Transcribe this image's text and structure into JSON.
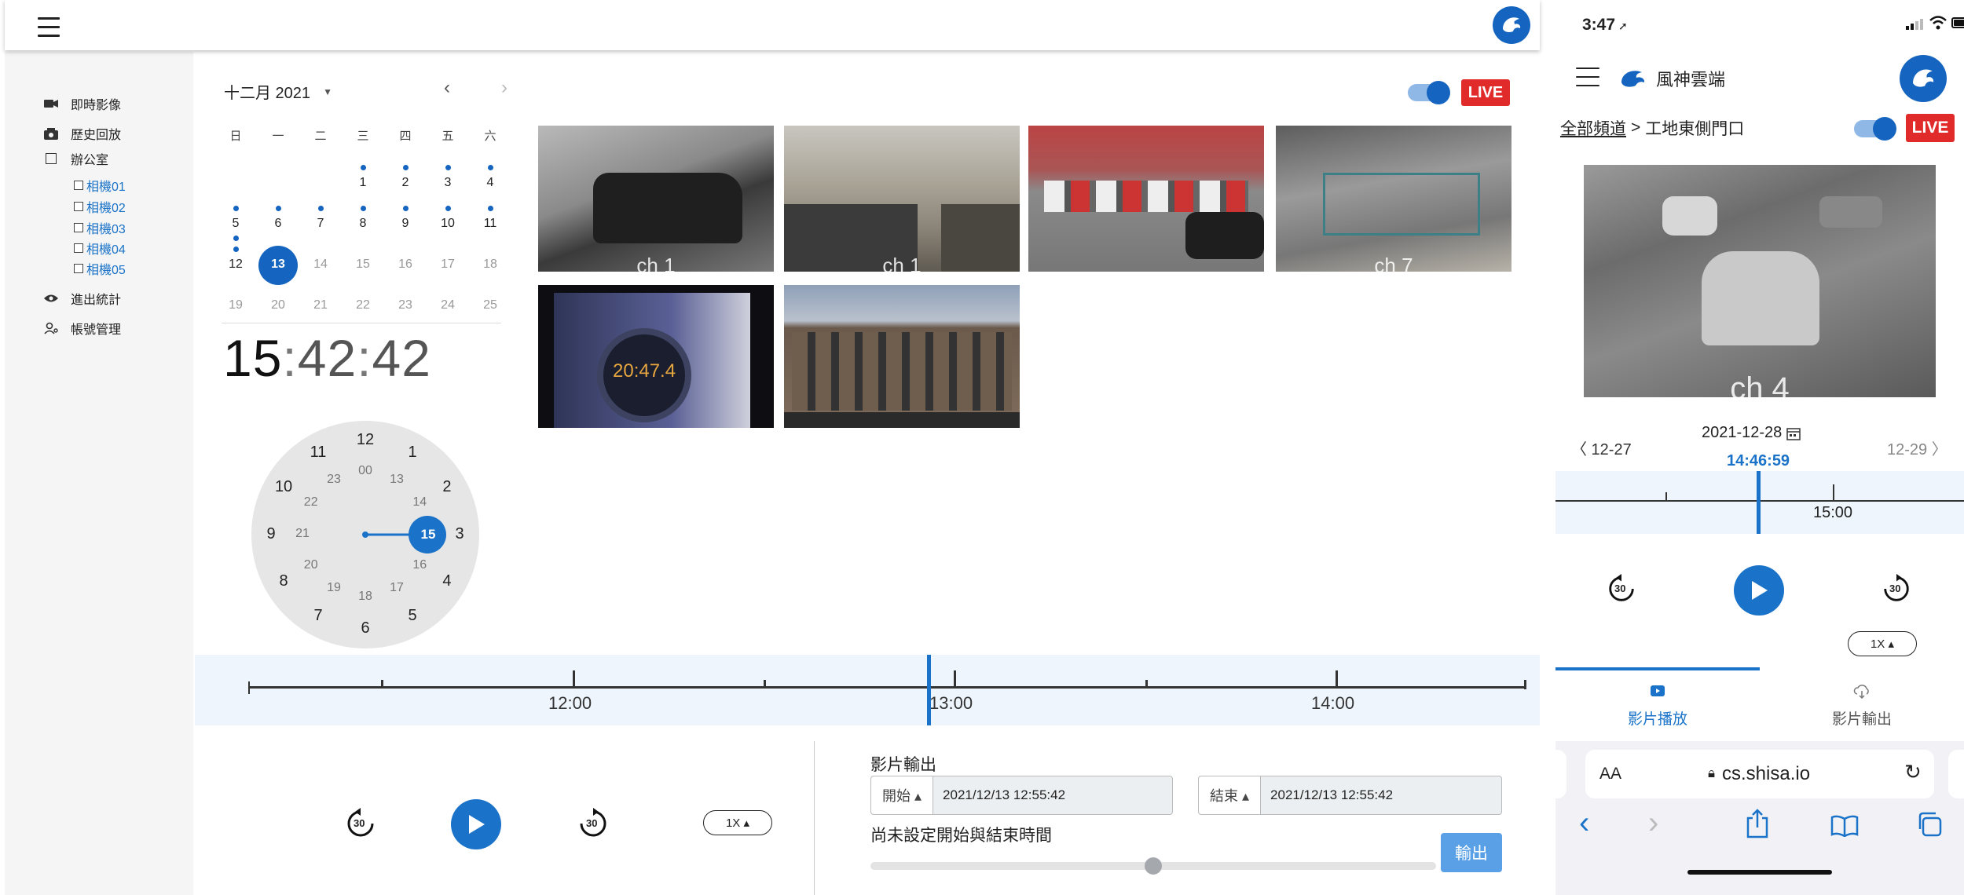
{
  "desktop": {
    "sidebar": {
      "items": [
        {
          "label": "即時影像",
          "icon": "video-camera-icon"
        },
        {
          "label": "歷史回放",
          "icon": "history-camera-icon"
        },
        {
          "label": "辦公室",
          "icon": "checkbox-icon"
        },
        {
          "label": "進出統計",
          "icon": "eye-icon"
        },
        {
          "label": "帳號管理",
          "icon": "user-settings-icon"
        }
      ],
      "cameras": [
        "相機01",
        "相機02",
        "相機03",
        "相機04",
        "相機05"
      ]
    },
    "calendar": {
      "month_label": "十二月 2021",
      "weekdays": [
        "日",
        "一",
        "二",
        "三",
        "四",
        "五",
        "六"
      ],
      "rows": [
        [
          "",
          "",
          "",
          "1",
          "2",
          "3",
          "4"
        ],
        [
          "5",
          "6",
          "7",
          "8",
          "9",
          "10",
          "11"
        ],
        [
          "12",
          "13",
          "14",
          "15",
          "16",
          "17",
          "18"
        ],
        [
          "19",
          "20",
          "21",
          "22",
          "23",
          "24",
          "25"
        ]
      ],
      "selected_day": "13",
      "dotted_days": [
        "1",
        "2",
        "3",
        "4",
        "5",
        "6",
        "7",
        "8",
        "9",
        "10",
        "11",
        "12"
      ]
    },
    "clock": {
      "hour": "15",
      "colon1": ":",
      "minute": "42",
      "colon2": ":",
      "second": "42",
      "outer_numbers": [
        "12",
        "1",
        "2",
        "3",
        "4",
        "5",
        "6",
        "7",
        "8",
        "9",
        "10",
        "11"
      ],
      "inner_numbers": [
        "00",
        "13",
        "14",
        "15",
        "16",
        "17",
        "18",
        "19",
        "20",
        "21",
        "22",
        "23"
      ],
      "selected": "15"
    },
    "live_label": "LIVE",
    "videos": [
      {
        "label": "ch 1"
      },
      {
        "label": "ch 1"
      },
      {
        "label": ""
      },
      {
        "label": "ch 7"
      },
      {
        "label": ""
      },
      {
        "label": ""
      }
    ],
    "video_overlay_time": "20:47.4",
    "timeline": {
      "ticks": [
        "12:00",
        "13:00",
        "14:00"
      ]
    },
    "playback": {
      "speed": "1X ▴",
      "skip_back": "30",
      "skip_fwd": "30"
    },
    "export": {
      "title": "影片輸出",
      "start_label": "開始 ▴",
      "start_value": "2021/12/13 12:55:42",
      "end_label": "結束 ▴",
      "end_value": "2021/12/13 12:55:42",
      "hint": "尚未設定開始與結束時間",
      "button": "輸出",
      "progress": 0.5
    }
  },
  "mobile": {
    "status": {
      "time": "3:47"
    },
    "brand": "風神雲端",
    "breadcrumb_root": "全部頻道",
    "breadcrumb_sep": ">",
    "breadcrumb_current": "工地東側門口",
    "live_label": "LIVE",
    "video_label": "ch 4",
    "date": "2021-12-28",
    "prev_day": "〈 12-27",
    "next_day": "12-29 〉",
    "current_time": "14:46:59",
    "timeline_tick": "15:00",
    "speed": "1X ▴",
    "skip": "30",
    "tabs": [
      {
        "label": "影片播放",
        "icon": "video-play-icon"
      },
      {
        "label": "影片輸出",
        "icon": "cloud-download-icon"
      }
    ],
    "browser": {
      "aa": "AA",
      "url": "cs.shisa.io"
    }
  },
  "colors": {
    "accent": "#1a73c8",
    "live": "#e12a2a",
    "sidebar": "#f5f5f5",
    "timeline": "#eef5fc"
  }
}
